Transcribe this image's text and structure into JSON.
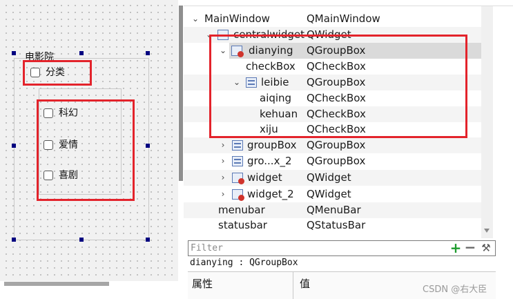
{
  "canvas": {
    "outer_group_title": "电影院",
    "checkboxes": {
      "fenlei": "分类",
      "kehuan": "科幻",
      "aiqing": "爱情",
      "xiju": "喜剧"
    }
  },
  "tree": {
    "rows": [
      {
        "name": "MainWindow",
        "cls": "QMainWindow"
      },
      {
        "name": "centralwidget",
        "cls": "QWidget"
      },
      {
        "name": "dianying",
        "cls": "QGroupBox"
      },
      {
        "name": "checkBox",
        "cls": "QCheckBox"
      },
      {
        "name": "leibie",
        "cls": "QGroupBox"
      },
      {
        "name": "aiqing",
        "cls": "QCheckBox"
      },
      {
        "name": "kehuan",
        "cls": "QCheckBox"
      },
      {
        "name": "xiju",
        "cls": "QCheckBox"
      },
      {
        "name": "groupBox",
        "cls": "QGroupBox"
      },
      {
        "name": "gro...x_2",
        "cls": "QGroupBox"
      },
      {
        "name": "widget",
        "cls": "QWidget"
      },
      {
        "name": "widget_2",
        "cls": "QWidget"
      },
      {
        "name": "menubar",
        "cls": "QMenuBar"
      },
      {
        "name": "statusbar",
        "cls": "QStatusBar"
      }
    ]
  },
  "filter": {
    "placeholder": "Filter"
  },
  "current_object": "dianying : QGroupBox",
  "property_header": {
    "name": "属性",
    "value": "值"
  },
  "watermark": "CSDN @右大臣",
  "colors": {
    "highlight_red": "#e3232b",
    "selection_handle": "#000080",
    "add_green": "#1e9c2e"
  }
}
